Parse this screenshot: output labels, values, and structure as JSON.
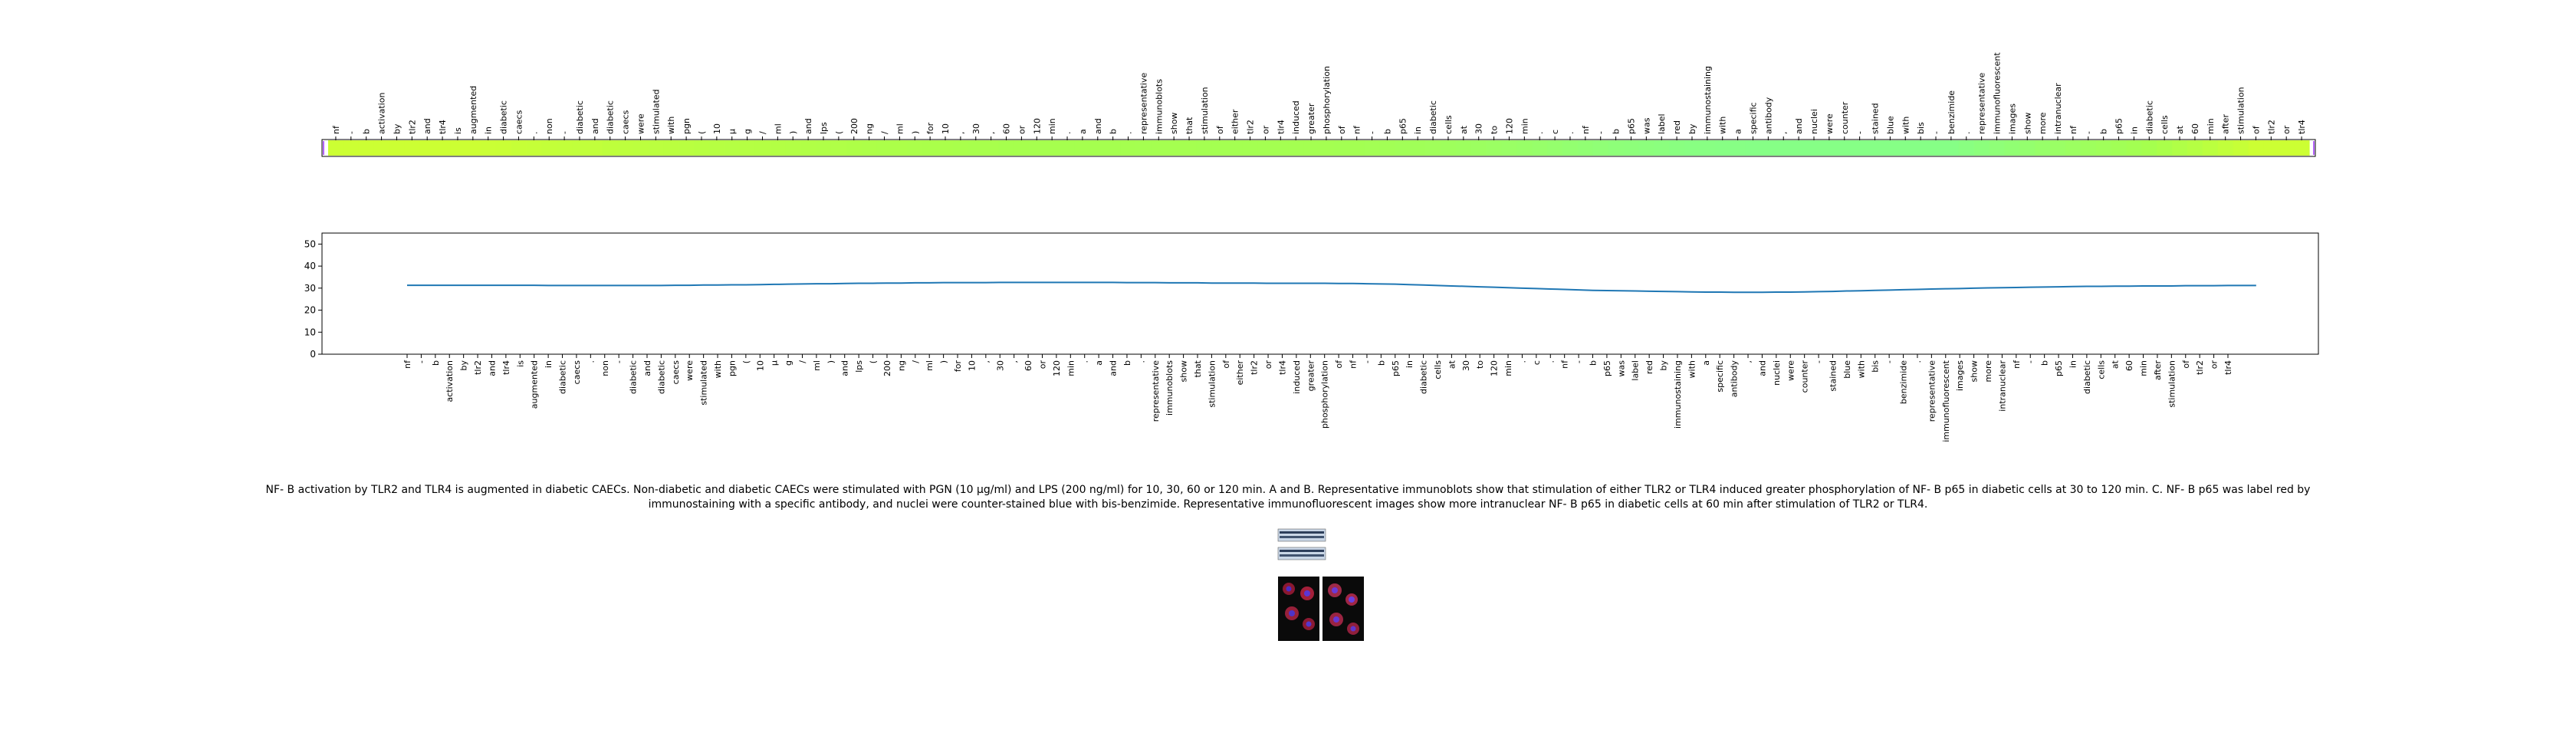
{
  "chart_data": [
    {
      "type": "heatmap",
      "tokens": [
        "nf",
        "-",
        "b",
        "activation",
        "by",
        "tlr2",
        "and",
        "tlr4",
        "is",
        "augmented",
        "in",
        "diabetic",
        "caecs",
        ".",
        "non",
        "-",
        "diabetic",
        "and",
        "diabetic",
        "caecs",
        "were",
        "stimulated",
        "with",
        "pgn",
        "(",
        "10",
        "μ",
        "g",
        "/",
        "ml",
        ")",
        "and",
        "lps",
        "(",
        "200",
        "ng",
        "/",
        "ml",
        ")",
        "for",
        "10",
        ",",
        "30",
        ",",
        "60",
        "or",
        "120",
        "min",
        ".",
        "a",
        "and",
        "b",
        ".",
        "representative",
        "immunoblots",
        "show",
        "that",
        "stimulation",
        "of",
        "either",
        "tlr2",
        "or",
        "tlr4",
        "induced",
        "greater",
        "phosphorylation",
        "of",
        "nf",
        "-",
        "b",
        "p65",
        "in",
        "diabetic",
        "cells",
        "at",
        "30",
        "to",
        "120",
        "min",
        ".",
        "c",
        ".",
        "nf",
        "-",
        "b",
        "p65",
        "was",
        "label",
        "red",
        "by",
        "immunostaining",
        "with",
        "a",
        "specific",
        "antibody",
        ",",
        "and",
        "nuclei",
        "were",
        "counter",
        "-",
        "stained",
        "blue",
        "with",
        "bis",
        "-",
        "benzimide",
        ".",
        "representative",
        "immunofluorescent",
        "images",
        "show",
        "more",
        "intranuclear",
        "nf",
        "-",
        "b",
        "p65",
        "in",
        "diabetic",
        "cells",
        "at",
        "60",
        "min",
        "after",
        "stimulation",
        "of",
        "tlr2",
        "or",
        "tlr4"
      ],
      "color_stops": [
        "#ccff33",
        "#a6ff4d",
        "#99ff66",
        "#86ff86"
      ],
      "color_values": [
        0.0,
        0.0,
        0.0,
        0.0,
        0.0,
        0.0,
        0.0,
        0.0,
        0.0,
        0.0,
        0.02,
        0.03,
        0.05,
        0.06,
        0.08,
        0.09,
        0.1,
        0.1,
        0.12,
        0.13,
        0.14,
        0.15,
        0.16,
        0.17,
        0.18,
        0.19,
        0.2,
        0.2,
        0.21,
        0.22,
        0.23,
        0.24,
        0.25,
        0.25,
        0.26,
        0.27,
        0.28,
        0.28,
        0.29,
        0.3,
        0.3,
        0.31,
        0.32,
        0.32,
        0.33,
        0.33,
        0.34,
        0.34,
        0.35,
        0.35,
        0.36,
        0.36,
        0.36,
        0.37,
        0.37,
        0.37,
        0.37,
        0.38,
        0.38,
        0.38,
        0.38,
        0.38,
        0.39,
        0.39,
        0.39,
        0.39,
        0.4,
        0.4,
        0.42,
        0.44,
        0.46,
        0.48,
        0.5,
        0.53,
        0.56,
        0.59,
        0.62,
        0.65,
        0.68,
        0.71,
        0.74,
        0.77,
        0.8,
        0.83,
        0.86,
        0.88,
        0.9,
        0.92,
        0.94,
        0.96,
        0.97,
        0.98,
        0.99,
        1.0,
        1.0,
        1.0,
        1.0,
        1.0,
        1.0,
        1.0,
        1.0,
        1.0,
        1.0,
        1.0,
        1.0,
        1.0,
        1.0,
        0.95,
        0.9,
        0.85,
        0.8,
        0.75,
        0.7,
        0.65,
        0.6,
        0.55,
        0.5,
        0.45,
        0.4,
        0.35,
        0.3,
        0.25,
        0.2,
        0.15,
        0.1,
        0.05,
        0.0,
        0.0,
        0.0,
        0.0,
        0.0,
        0.0,
        0.0
      ]
    },
    {
      "type": "line",
      "x": [
        "nf",
        "-",
        "b",
        "activation",
        "by",
        "tlr2",
        "and",
        "tlr4",
        "is",
        "augmented",
        "in",
        "diabetic",
        "caecs",
        ".",
        "non",
        "-",
        "diabetic",
        "and",
        "diabetic",
        "caecs",
        "were",
        "stimulated",
        "with",
        "pgn",
        "(",
        "10",
        "μ",
        "g",
        "/",
        "ml",
        ")",
        "and",
        "lps",
        "(",
        "200",
        "ng",
        "/",
        "ml",
        ")",
        "for",
        "10",
        ",",
        "30",
        ",",
        "60",
        "or",
        "120",
        "min",
        ".",
        "a",
        "and",
        "b",
        ".",
        "representative",
        "immunoblots",
        "show",
        "that",
        "stimulation",
        "of",
        "either",
        "tlr2",
        "or",
        "tlr4",
        "induced",
        "greater",
        "phosphorylation",
        "of",
        "nf",
        "-",
        "b",
        "p65",
        "in",
        "diabetic",
        "cells",
        "at",
        "30",
        "to",
        "120",
        "min",
        ".",
        "c",
        ".",
        "nf",
        "-",
        "b",
        "p65",
        "was",
        "label",
        "red",
        "by",
        "immunostaining",
        "with",
        "a",
        "specific",
        "antibody",
        ",",
        "and",
        "nuclei",
        "were",
        "counter",
        "-",
        "stained",
        "blue",
        "with",
        "bis",
        "-",
        "benzimide",
        ".",
        "representative",
        "immunofluorescent",
        "images",
        "show",
        "more",
        "intranuclear",
        "nf",
        "-",
        "b",
        "p65",
        "in",
        "diabetic",
        "cells",
        "at",
        "60",
        "min",
        "after",
        "stimulation",
        "of",
        "tlr2",
        "or",
        "tlr4"
      ],
      "series": [
        {
          "values": [
            31.3,
            31.3,
            31.3,
            31.3,
            31.3,
            31.3,
            31.3,
            31.3,
            31.3,
            31.3,
            31.2,
            31.2,
            31.2,
            31.2,
            31.2,
            31.2,
            31.2,
            31.2,
            31.2,
            31.3,
            31.3,
            31.4,
            31.4,
            31.5,
            31.5,
            31.6,
            31.7,
            31.8,
            31.9,
            32.0,
            32.0,
            32.1,
            32.2,
            32.2,
            32.3,
            32.3,
            32.4,
            32.4,
            32.5,
            32.5,
            32.5,
            32.5,
            32.6,
            32.6,
            32.6,
            32.6,
            32.6,
            32.6,
            32.6,
            32.6,
            32.6,
            32.5,
            32.5,
            32.5,
            32.4,
            32.4,
            32.4,
            32.3,
            32.3,
            32.3,
            32.3,
            32.2,
            32.2,
            32.2,
            32.2,
            32.2,
            32.1,
            32.1,
            32.0,
            31.9,
            31.8,
            31.6,
            31.4,
            31.2,
            31.0,
            30.8,
            30.6,
            30.4,
            30.2,
            30.0,
            29.8,
            29.6,
            29.4,
            29.2,
            29.0,
            28.9,
            28.8,
            28.7,
            28.6,
            28.5,
            28.4,
            28.3,
            28.2,
            28.2,
            28.1,
            28.1,
            28.1,
            28.2,
            28.2,
            28.3,
            28.4,
            28.5,
            28.7,
            28.8,
            29.0,
            29.1,
            29.3,
            29.4,
            29.6,
            29.7,
            29.8,
            30.0,
            30.1,
            30.2,
            30.3,
            30.4,
            30.5,
            30.6,
            30.7,
            30.8,
            30.8,
            30.9,
            30.9,
            31.0,
            31.0,
            31.0,
            31.1,
            31.1,
            31.1,
            31.2,
            31.2,
            31.2
          ]
        }
      ],
      "ylim": [
        0,
        55
      ],
      "yticks": [
        0,
        10,
        20,
        30,
        40,
        50
      ],
      "line_color": "#1f77b4",
      "grid": false
    }
  ],
  "caption": "NF- B activation by TLR2 and TLR4 is augmented in diabetic CAECs. Non-diabetic and diabetic CAECs were stimulated with PGN (10 μg/ml) and LPS (200 ng/ml) for 10, 30, 60 or 120 min. A and B. Representative immunoblots show that stimulation of either TLR2 or TLR4 induced greater phosphorylation of NF- B p65 in diabetic cells at 30 to 120 min. C. NF- B p65 was label red by immunostaining with a specific antibody, and nuclei were counter-stained blue with bis-benzimide. Representative immunofluorescent images show more intranuclear NF- B p65 in diabetic cells at 60 min after stimulation of TLR2 or TLR4.",
  "thumbnail": {
    "kind": "figure-thumbnail",
    "panels": [
      "immunoblots",
      "immunofluorescence"
    ]
  }
}
